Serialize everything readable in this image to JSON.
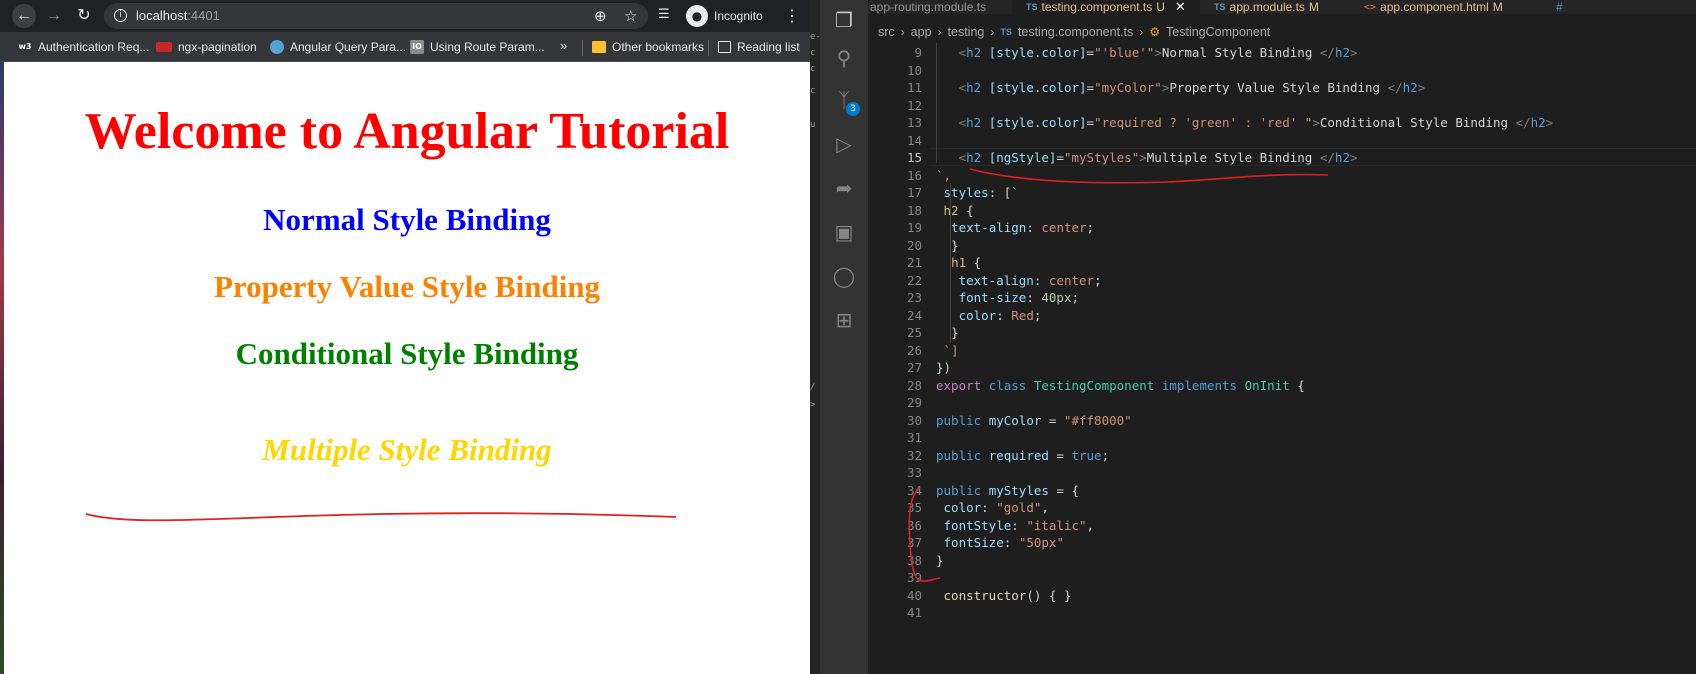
{
  "browser": {
    "url_host": "localhost",
    "url_port": ":4401",
    "incognito_label": "Incognito",
    "bookmarks": [
      {
        "label": "Authentication Req...",
        "icon": "w3-icon",
        "icon_text": "w3"
      },
      {
        "label": "ngx-pagination",
        "icon": "ngx-icon",
        "icon_text": "ngx"
      },
      {
        "label": "Angular Query Para...",
        "icon": "hexagon-icon",
        "icon_text": ""
      },
      {
        "label": "Using Route Param...",
        "icon": "bookmark-icon",
        "icon_text": "IO"
      }
    ],
    "bookmarks_more": "»",
    "other_bookmarks": "Other bookmarks",
    "reading_list": "Reading list",
    "page": {
      "title": "Welcome to Angular Tutorial",
      "title_color": "#ff0000",
      "headings": [
        {
          "text": "Normal Style Binding",
          "color": "blue"
        },
        {
          "text": "Property Value Style Binding",
          "color": "#ff8000"
        },
        {
          "text": "Conditional Style Binding",
          "color": "green"
        },
        {
          "text": "Multiple Style Binding",
          "color": "gold"
        }
      ]
    }
  },
  "vscode": {
    "sidebar_fragments": [
      "e-",
      "c",
      "c",
      "c",
      "u",
      "/",
      ">"
    ],
    "activity_badge": "3",
    "tabs": [
      {
        "label": "app-routing.module.ts",
        "icon": "typescript-icon"
      },
      {
        "label": "testing.component.ts",
        "status": "U",
        "icon": "typescript-icon",
        "active": true
      },
      {
        "label": "app.module.ts",
        "status": "M",
        "icon": "typescript-icon"
      },
      {
        "label": "app.component.html",
        "status": "M",
        "icon": "html-icon"
      },
      {
        "label": "",
        "icon": "css-icon"
      }
    ],
    "breadcrumb": [
      "src",
      "app",
      "testing",
      "testing.component.ts",
      "TestingComponent"
    ],
    "lines": [
      {
        "n": "9"
      },
      {
        "n": "10"
      },
      {
        "n": "11"
      },
      {
        "n": "12"
      },
      {
        "n": "13"
      },
      {
        "n": "14"
      },
      {
        "n": "15"
      },
      {
        "n": "16"
      },
      {
        "n": "17"
      },
      {
        "n": "18"
      },
      {
        "n": "19"
      },
      {
        "n": "20"
      },
      {
        "n": "21"
      },
      {
        "n": "22"
      },
      {
        "n": "23"
      },
      {
        "n": "24"
      },
      {
        "n": "25"
      },
      {
        "n": "26"
      },
      {
        "n": "27"
      },
      {
        "n": "28"
      },
      {
        "n": "29"
      },
      {
        "n": "30"
      },
      {
        "n": "31"
      },
      {
        "n": "32"
      },
      {
        "n": "33"
      },
      {
        "n": "34"
      },
      {
        "n": "35"
      },
      {
        "n": "36"
      },
      {
        "n": "37"
      },
      {
        "n": "38"
      },
      {
        "n": "39"
      },
      {
        "n": "40"
      },
      {
        "n": "41"
      }
    ],
    "code": {
      "l9": [
        "<",
        "h2",
        "[style.color]",
        "=",
        "\"'blue'\"",
        ">",
        "Normal Style Binding ",
        "</",
        "h2",
        ">"
      ],
      "l11": [
        "<",
        "h2",
        "[style.color]",
        "=",
        "\"myColor\"",
        ">",
        "Property Value Style Binding ",
        "</",
        "h2",
        ">"
      ],
      "l13": [
        "<",
        "h2",
        "[style.color]",
        "=",
        "\"required ? 'green' : 'red' \"",
        ">",
        "Conditional Style Binding ",
        "</",
        "h2",
        ">"
      ],
      "l15": [
        "<",
        "h2",
        "[ngStyle]",
        "=",
        "\"myStyles\"",
        ">",
        "Multiple Style Binding ",
        "</",
        "h2",
        ">"
      ],
      "l16": "`,",
      "l17": [
        "styles",
        ": [`"
      ],
      "l18": [
        "h2",
        " {"
      ],
      "l19": [
        "text-align",
        ": ",
        "center",
        ";"
      ],
      "l20": "}",
      "l21": [
        "h1",
        " {"
      ],
      "l22": [
        "text-align",
        ": ",
        "center",
        ";"
      ],
      "l23": [
        "font-size",
        ": ",
        "40px",
        ";"
      ],
      "l24": [
        "color",
        ": ",
        "Red",
        ";"
      ],
      "l25": "}",
      "l26": "`]",
      "l27": "})",
      "l28": [
        "export",
        " ",
        "class",
        " ",
        "TestingComponent",
        " ",
        "implements",
        " ",
        "OnInit",
        " {"
      ],
      "l30": [
        "public",
        " ",
        "myColor",
        " = ",
        "\"#ff8000\""
      ],
      "l32": [
        "public",
        " ",
        "required",
        " = ",
        "true",
        ";"
      ],
      "l34": [
        "public",
        " ",
        "myStyles",
        " = {"
      ],
      "l35": [
        "color",
        ": ",
        "\"gold\"",
        ","
      ],
      "l36": [
        "fontStyle",
        ": ",
        "\"italic\"",
        ","
      ],
      "l37": [
        "fontSize",
        ": ",
        "\"50px\""
      ],
      "l38": "}",
      "l40": [
        "constructor",
        "() { }"
      ]
    }
  }
}
